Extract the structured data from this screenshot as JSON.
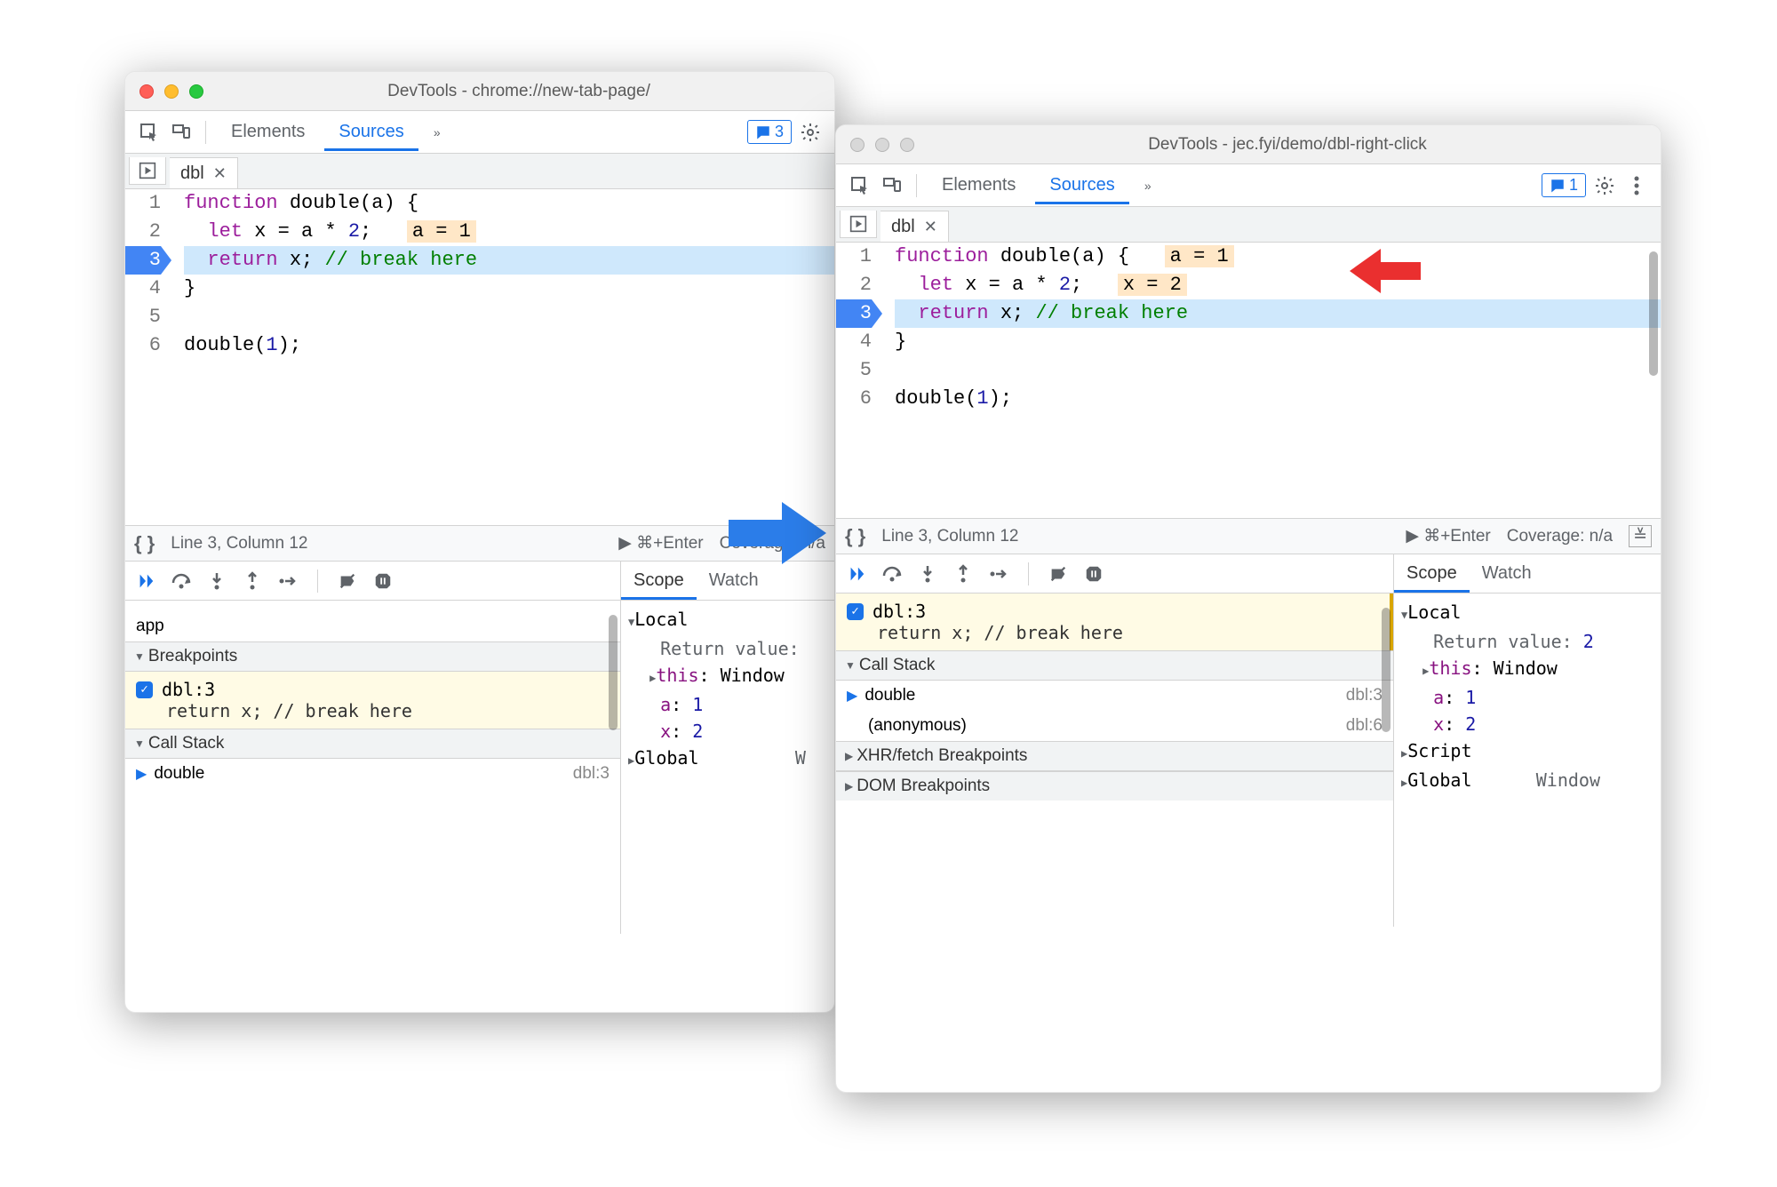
{
  "window1": {
    "title": "DevTools - chrome://new-tab-page/",
    "traffic_active": true,
    "feedback_count": "3",
    "tabs": {
      "elements": "Elements",
      "sources": "Sources"
    },
    "file_tab": "dbl",
    "code": {
      "l1": "function double(a) {",
      "l2a": "  let x = a * 2;",
      "l2b": "a = 1",
      "l3a": "  return x;",
      "l3b": "// break here",
      "l4": "}",
      "l6": "double(1);"
    },
    "status": {
      "pos": "Line 3, Column 12",
      "run": "⌘+Enter",
      "cov": "Coverage: n/a"
    },
    "left_items": {
      "item1": "app"
    },
    "bp_section": "Breakpoints",
    "bp_label": "dbl:3",
    "bp_code": "return x; // break here",
    "cs_section": "Call Stack",
    "cs_item": "double",
    "cs_loc": "dbl:3",
    "scope_tab": "Scope",
    "watch_tab": "Watch",
    "scope": {
      "local": "Local",
      "retval": "Return value:",
      "this": "this",
      "this_val": "Window",
      "a": "a",
      "a_val": "1",
      "x": "x",
      "x_val": "2",
      "global": "Global",
      "global_val": "W"
    }
  },
  "window2": {
    "title": "DevTools - jec.fyi/demo/dbl-right-click",
    "feedback_count": "1",
    "tabs": {
      "elements": "Elements",
      "sources": "Sources"
    },
    "file_tab": "dbl",
    "code": {
      "l1a": "function double(a) {",
      "l1b": "a = 1",
      "l2a": "  let x = a * 2;",
      "l2b": "x = 2",
      "l3a": "  return x;",
      "l3b": "// break here",
      "l4": "}",
      "l6": "double(1);"
    },
    "status": {
      "pos": "Line 3, Column 12",
      "run": "⌘+Enter",
      "cov": "Coverage: n/a"
    },
    "bp_label": "dbl:3",
    "bp_code": "return x; // break here",
    "cs_section": "Call Stack",
    "cs_item1": "double",
    "cs_loc1": "dbl:3",
    "cs_item2": "(anonymous)",
    "cs_loc2": "dbl:6",
    "xhr_section": "XHR/fetch Breakpoints",
    "dom_section": "DOM Breakpoints",
    "scope_tab": "Scope",
    "watch_tab": "Watch",
    "scope": {
      "local": "Local",
      "retval_label": "Return value:",
      "retval_val": "2",
      "this": "this",
      "this_val": "Window",
      "a": "a",
      "a_val": "1",
      "x": "x",
      "x_val": "2",
      "script": "Script",
      "global": "Global",
      "global_val": "Window"
    }
  }
}
